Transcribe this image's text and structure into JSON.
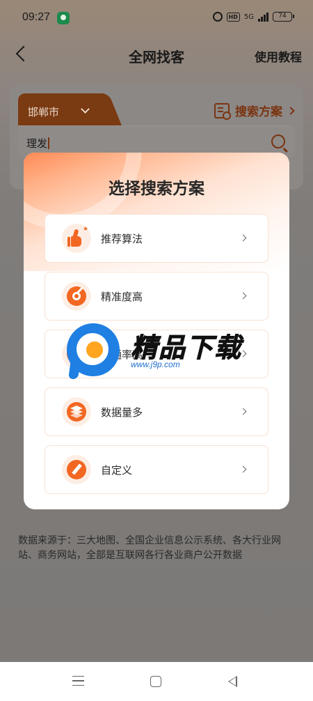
{
  "status_bar": {
    "time": "09:27",
    "network": "5G",
    "hd": "HD",
    "battery": "74"
  },
  "nav": {
    "title": "全网找客",
    "help_label": "使用教程"
  },
  "search_card": {
    "city": "邯郸市",
    "scheme_link": "搜索方案",
    "search_value": "理发"
  },
  "modal": {
    "title": "选择搜索方案",
    "options": [
      {
        "label": "推荐算法",
        "icon": "thumbs-up-icon"
      },
      {
        "label": "精准度高",
        "icon": "target-icon"
      },
      {
        "label": "接通率高",
        "icon": "percent-icon"
      },
      {
        "label": "数据量多",
        "icon": "layers-icon"
      },
      {
        "label": "自定义",
        "icon": "pencil-icon"
      }
    ]
  },
  "footer_note": "数据来源于：三大地图、全国企业信息公示系统、各大行业网站、商务网站，全部是互联网各行各业商户公开数据",
  "watermark": {
    "title": "精品下载",
    "url": "www.j9p.com"
  },
  "colors": {
    "accent": "#f26722",
    "accent_light": "#fdeee5",
    "dim_overlay": "#7c7977",
    "watermark_blue": "#1f7fe3"
  }
}
